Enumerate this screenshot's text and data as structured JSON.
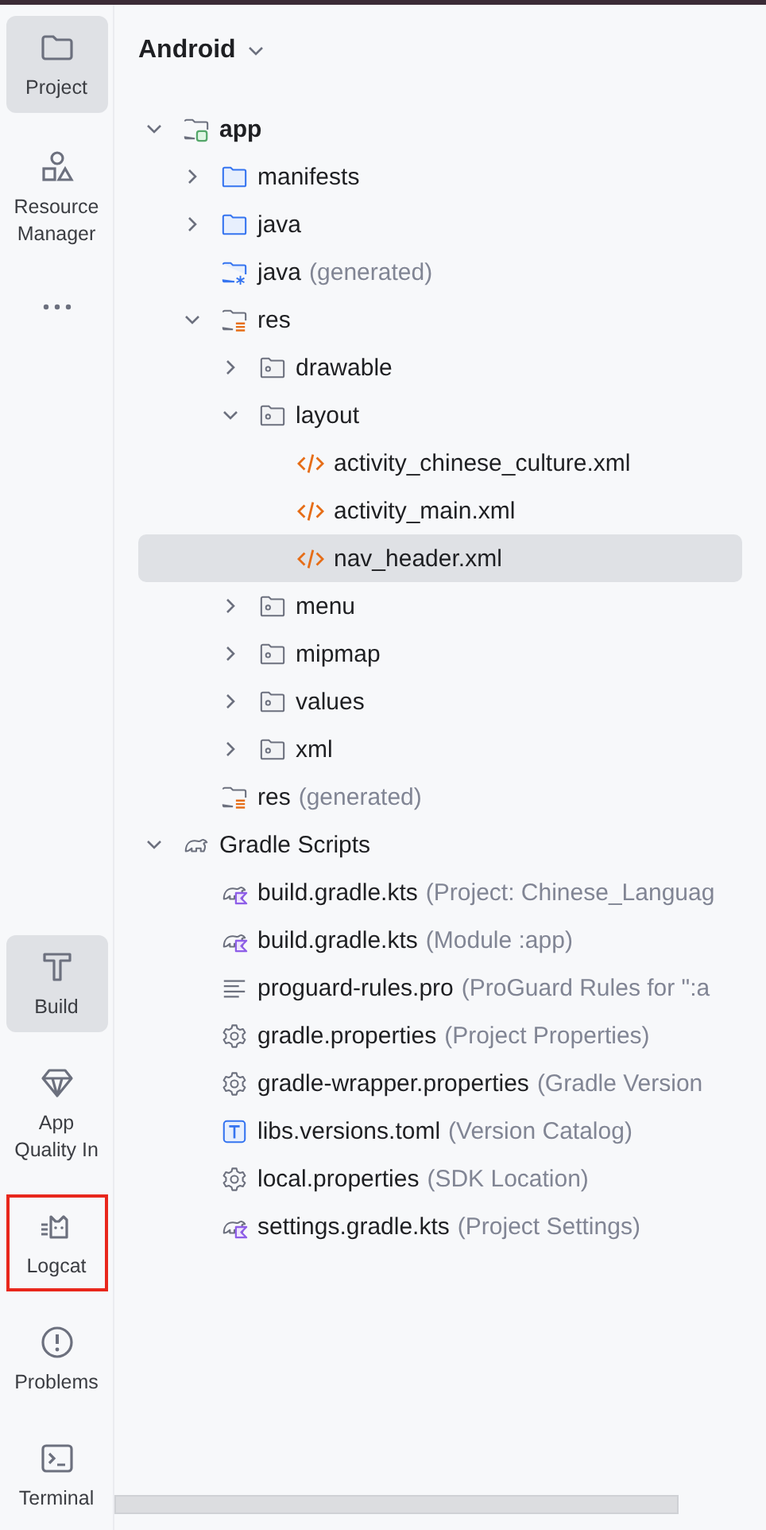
{
  "tool_strip": {
    "top": [
      {
        "label": "Project",
        "kind": "folder",
        "selected": true,
        "highlighted": false
      },
      {
        "label": "Resource Manager",
        "kind": "shapes",
        "selected": false,
        "highlighted": false
      },
      {
        "kind": "more",
        "selected": false,
        "highlighted": false
      }
    ],
    "bottom": [
      {
        "label": "Build",
        "kind": "hammer",
        "selected": true,
        "highlighted": false
      },
      {
        "label": "App Quality In",
        "kind": "gem",
        "selected": false,
        "highlighted": false
      },
      {
        "label": "Logcat",
        "kind": "cat",
        "selected": false,
        "highlighted": true
      },
      {
        "label": "Problems",
        "kind": "alert",
        "selected": false,
        "highlighted": false
      },
      {
        "label": "Terminal",
        "kind": "terminal",
        "selected": false,
        "highlighted": false
      }
    ]
  },
  "panel": {
    "view": "Android"
  },
  "tree": [
    {
      "label": "app",
      "kind": "module",
      "bold": true,
      "expanded": true,
      "selected": false,
      "children": [
        {
          "label": "manifests",
          "kind": "folder",
          "expanded": false,
          "selected": false
        },
        {
          "label": "java",
          "kind": "folder",
          "expanded": false,
          "selected": false
        },
        {
          "label": "java",
          "note": "(generated)",
          "kind": "folder-generated",
          "selected": false
        },
        {
          "label": "res",
          "kind": "res-folder",
          "expanded": true,
          "selected": false,
          "children": [
            {
              "label": "drawable",
              "kind": "res-dir",
              "expanded": false,
              "selected": false
            },
            {
              "label": "layout",
              "kind": "res-dir",
              "expanded": true,
              "selected": false,
              "children": [
                {
                  "label": "activity_chinese_culture.xml",
                  "kind": "xml",
                  "selected": false
                },
                {
                  "label": "activity_main.xml",
                  "kind": "xml",
                  "selected": false
                },
                {
                  "label": "nav_header.xml",
                  "kind": "xml",
                  "selected": true
                }
              ]
            },
            {
              "label": "menu",
              "kind": "res-dir",
              "expanded": false,
              "selected": false
            },
            {
              "label": "mipmap",
              "kind": "res-dir",
              "expanded": false,
              "selected": false
            },
            {
              "label": "values",
              "kind": "res-dir",
              "expanded": false,
              "selected": false
            },
            {
              "label": "xml",
              "kind": "res-dir",
              "expanded": false,
              "selected": false
            }
          ]
        },
        {
          "label": "res",
          "note": "(generated)",
          "kind": "res-folder",
          "selected": false
        }
      ]
    },
    {
      "label": "Gradle Scripts",
      "kind": "gradle",
      "expanded": true,
      "selected": false,
      "children": [
        {
          "label": "build.gradle.kts",
          "note": "(Project: Chinese_Languag",
          "kind": "gradle-kts",
          "selected": false
        },
        {
          "label": "build.gradle.kts",
          "note": "(Module :app)",
          "kind": "gradle-kts",
          "selected": false
        },
        {
          "label": "proguard-rules.pro",
          "note": "(ProGuard Rules for \":a",
          "kind": "lines",
          "selected": false
        },
        {
          "label": "gradle.properties",
          "note": "(Project Properties)",
          "kind": "gear",
          "selected": false
        },
        {
          "label": "gradle-wrapper.properties",
          "note": "(Gradle Version",
          "kind": "gear",
          "selected": false
        },
        {
          "label": "libs.versions.toml",
          "note": "(Version Catalog)",
          "kind": "toml",
          "selected": false
        },
        {
          "label": "local.properties",
          "note": "(SDK Location)",
          "kind": "gear",
          "selected": false
        },
        {
          "label": "settings.gradle.kts",
          "note": "(Project Settings)",
          "kind": "gradle-kts",
          "selected": false
        }
      ]
    }
  ]
}
